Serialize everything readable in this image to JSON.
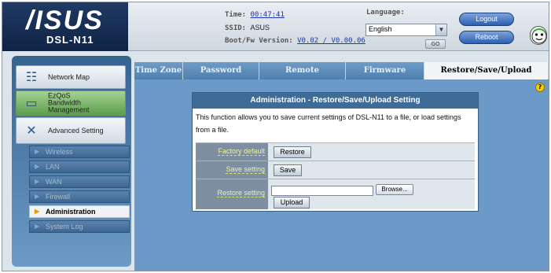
{
  "brand": {
    "logo": "/ISUS",
    "model": "DSL-N11"
  },
  "status": {
    "time_label": "Time:",
    "time_value": "00:47:41",
    "ssid_label": "SSID:",
    "ssid_value": "ASUS",
    "fw_label": "Boot/Fw Version:",
    "fw_value": "V0.02 / V0.00.06"
  },
  "language": {
    "label": "Language:",
    "selected": "English",
    "go_label": "GO"
  },
  "header_buttons": {
    "logout": "Logout",
    "reboot": "Reboot"
  },
  "sidebar": {
    "items": [
      {
        "label": "Network Map",
        "icon": "network-map-icon"
      },
      {
        "label": "EzQoS\nBandwidth\nManagement",
        "icon": "bandwidth-icon"
      },
      {
        "label": "Advanced Setting",
        "icon": "wrench-icon"
      }
    ],
    "sub_items": [
      {
        "label": "Wireless"
      },
      {
        "label": "LAN"
      },
      {
        "label": "WAN"
      },
      {
        "label": "Firewall"
      },
      {
        "label": "Administration",
        "active": true
      },
      {
        "label": "System Log"
      }
    ]
  },
  "tabs": [
    {
      "label": "Time Zone"
    },
    {
      "label": "Password Setting"
    },
    {
      "label": "Remote Management"
    },
    {
      "label": "Firmware Upgrade"
    },
    {
      "label": "Restore/Save/Upload Setting",
      "active": true
    }
  ],
  "panel": {
    "title": "Administration - Restore/Save/Upload Setting",
    "description": "This function allows you to save current settings of DSL-N11 to a file, or load settings from a file.",
    "rows": [
      {
        "label": "Factory default",
        "button": "Restore"
      },
      {
        "label": "Save setting",
        "button": "Save"
      },
      {
        "label": "Restore setting",
        "browse": "Browse...",
        "button": "Upload"
      }
    ],
    "help_icon": "?"
  },
  "colors": {
    "accent": "#3f6b97",
    "sidebar": "#36638f",
    "active_tab": "#f2f5f8"
  }
}
